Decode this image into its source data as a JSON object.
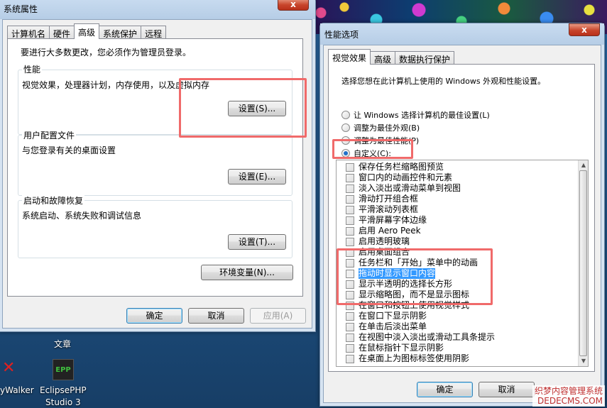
{
  "desktop": {
    "icons": [
      {
        "label": "文章"
      },
      {
        "label": "yWalker"
      },
      {
        "label": "EclipsePHP"
      },
      {
        "label": "Studio 3"
      }
    ],
    "epp_logo": "EPP"
  },
  "sys_props": {
    "title": "系统属性",
    "close": "x",
    "tabs": [
      "计算机名",
      "硬件",
      "高级",
      "系统保护",
      "远程"
    ],
    "admin_note": "要进行大多数更改，您必须作为管理员登录。",
    "perf_label": "性能",
    "perf_desc": "视觉效果，处理器计划，内存使用，以及虚拟内存",
    "perf_btn": "设置(S)...",
    "profile_label": "用户配置文件",
    "profile_desc": "与您登录有关的桌面设置",
    "profile_btn": "设置(E)...",
    "startup_label": "启动和故障恢复",
    "startup_desc": "系统启动、系统失败和调试信息",
    "startup_btn": "设置(T)...",
    "env_btn": "环境变量(N)...",
    "ok": "确定",
    "cancel": "取消",
    "apply": "应用(A)"
  },
  "perf_opts": {
    "title": "性能选项",
    "close": "x",
    "tabs": [
      "视觉效果",
      "高级",
      "数据执行保护"
    ],
    "intro": "选择您想在此计算机上使用的 Windows 外观和性能设置。",
    "radios": [
      {
        "label": "让 Windows 选择计算机的最佳设置(L)",
        "checked": false
      },
      {
        "label": "调整为最佳外观(B)",
        "checked": false
      },
      {
        "label": "调整为最佳性能(P)",
        "checked": false
      },
      {
        "label": "自定义(C):",
        "checked": true
      }
    ],
    "options": [
      {
        "label": "保存任务栏缩略图预览"
      },
      {
        "label": "窗口内的动画控件和元素"
      },
      {
        "label": "淡入淡出或滑动菜单到视图"
      },
      {
        "label": "滑动打开组合框"
      },
      {
        "label": "平滑滚动列表框"
      },
      {
        "label": "平滑屏幕字体边缘"
      },
      {
        "label": "启用 Aero Peek"
      },
      {
        "label": "启用透明玻璃"
      },
      {
        "label": "启用桌面组合"
      },
      {
        "label": "任务栏和「开始」菜单中的动画"
      },
      {
        "label": "拖动时显示窗口内容"
      },
      {
        "label": "显示半透明的选择长方形"
      },
      {
        "label": "显示缩略图，而不是显示图标"
      },
      {
        "label": "在窗口和按钮上使用视觉样式"
      },
      {
        "label": "在窗口下显示阴影"
      },
      {
        "label": "在单击后淡出菜单"
      },
      {
        "label": "在视图中淡入淡出或滑动工具条提示"
      },
      {
        "label": "在鼠标指针下显示阴影"
      },
      {
        "label": "在桌面上为图标标签使用阴影"
      }
    ],
    "selected_option": "拖动时显示窗口内容",
    "ok": "确定",
    "cancel": "取消"
  },
  "watermark": {
    "line1": "织梦内容管理系统",
    "line2": "DEDECMS.COM"
  },
  "colors": {
    "highlight_box": "#f06a6a",
    "selection": "#3399ff"
  }
}
